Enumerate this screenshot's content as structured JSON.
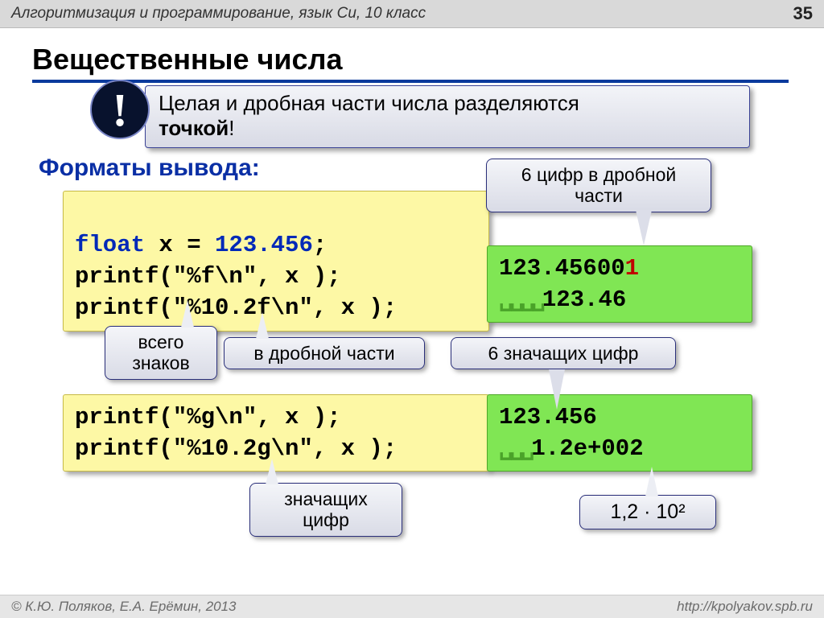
{
  "header": {
    "subject": "Алгоритмизация и программирование, язык Си, 10 класс",
    "page": "35"
  },
  "title": "Вещественные числа",
  "disc": "!",
  "note": {
    "line1": "Целая и дробная части числа разделяются",
    "bold": "точкой",
    "excl": "!"
  },
  "sub1": "Форматы вывода:",
  "code1": {
    "l1a": "float",
    "l1b": " x = ",
    "l1c": "123.456",
    "l1d": ";",
    "l2": "printf(\"%f\\n\", x );",
    "l3": "printf(\"%10.2f\\n\", x );"
  },
  "out1": {
    "l1a": "123.45600",
    "l1b": "1",
    "sp": "␣␣␣␣",
    "l2": "123.46"
  },
  "callouts": {
    "c1": "6 цифр в дробной\nчасти",
    "c2": "всего\nзнаков",
    "c3": "в дробной части",
    "c4": "6 значащих цифр",
    "c5": "значащих\nцифр",
    "c6": "1,2 · 10²"
  },
  "code2": {
    "l1": "printf(\"%g\\n\", x );",
    "l2": "printf(\"%10.2g\\n\", x );"
  },
  "out2": {
    "l1": "123.456",
    "sp": "␣␣␣",
    "l2": "1.2e+002"
  },
  "footer": {
    "left": "© К.Ю. Поляков, Е.А. Ерёмин, 2013",
    "right": "http://kpolyakov.spb.ru"
  }
}
